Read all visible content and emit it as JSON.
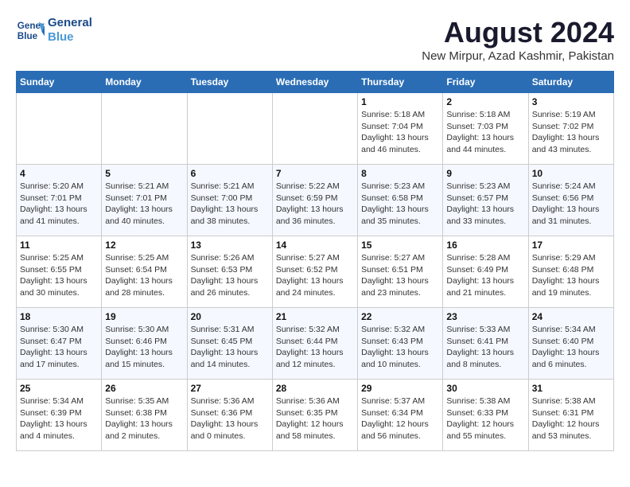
{
  "logo": {
    "line1": "General",
    "line2": "Blue"
  },
  "title": "August 2024",
  "location": "New Mirpur, Azad Kashmir, Pakistan",
  "days_of_week": [
    "Sunday",
    "Monday",
    "Tuesday",
    "Wednesday",
    "Thursday",
    "Friday",
    "Saturday"
  ],
  "weeks": [
    [
      {
        "day": "",
        "detail": ""
      },
      {
        "day": "",
        "detail": ""
      },
      {
        "day": "",
        "detail": ""
      },
      {
        "day": "",
        "detail": ""
      },
      {
        "day": "1",
        "detail": "Sunrise: 5:18 AM\nSunset: 7:04 PM\nDaylight: 13 hours\nand 46 minutes."
      },
      {
        "day": "2",
        "detail": "Sunrise: 5:18 AM\nSunset: 7:03 PM\nDaylight: 13 hours\nand 44 minutes."
      },
      {
        "day": "3",
        "detail": "Sunrise: 5:19 AM\nSunset: 7:02 PM\nDaylight: 13 hours\nand 43 minutes."
      }
    ],
    [
      {
        "day": "4",
        "detail": "Sunrise: 5:20 AM\nSunset: 7:01 PM\nDaylight: 13 hours\nand 41 minutes."
      },
      {
        "day": "5",
        "detail": "Sunrise: 5:21 AM\nSunset: 7:01 PM\nDaylight: 13 hours\nand 40 minutes."
      },
      {
        "day": "6",
        "detail": "Sunrise: 5:21 AM\nSunset: 7:00 PM\nDaylight: 13 hours\nand 38 minutes."
      },
      {
        "day": "7",
        "detail": "Sunrise: 5:22 AM\nSunset: 6:59 PM\nDaylight: 13 hours\nand 36 minutes."
      },
      {
        "day": "8",
        "detail": "Sunrise: 5:23 AM\nSunset: 6:58 PM\nDaylight: 13 hours\nand 35 minutes."
      },
      {
        "day": "9",
        "detail": "Sunrise: 5:23 AM\nSunset: 6:57 PM\nDaylight: 13 hours\nand 33 minutes."
      },
      {
        "day": "10",
        "detail": "Sunrise: 5:24 AM\nSunset: 6:56 PM\nDaylight: 13 hours\nand 31 minutes."
      }
    ],
    [
      {
        "day": "11",
        "detail": "Sunrise: 5:25 AM\nSunset: 6:55 PM\nDaylight: 13 hours\nand 30 minutes."
      },
      {
        "day": "12",
        "detail": "Sunrise: 5:25 AM\nSunset: 6:54 PM\nDaylight: 13 hours\nand 28 minutes."
      },
      {
        "day": "13",
        "detail": "Sunrise: 5:26 AM\nSunset: 6:53 PM\nDaylight: 13 hours\nand 26 minutes."
      },
      {
        "day": "14",
        "detail": "Sunrise: 5:27 AM\nSunset: 6:52 PM\nDaylight: 13 hours\nand 24 minutes."
      },
      {
        "day": "15",
        "detail": "Sunrise: 5:27 AM\nSunset: 6:51 PM\nDaylight: 13 hours\nand 23 minutes."
      },
      {
        "day": "16",
        "detail": "Sunrise: 5:28 AM\nSunset: 6:49 PM\nDaylight: 13 hours\nand 21 minutes."
      },
      {
        "day": "17",
        "detail": "Sunrise: 5:29 AM\nSunset: 6:48 PM\nDaylight: 13 hours\nand 19 minutes."
      }
    ],
    [
      {
        "day": "18",
        "detail": "Sunrise: 5:30 AM\nSunset: 6:47 PM\nDaylight: 13 hours\nand 17 minutes."
      },
      {
        "day": "19",
        "detail": "Sunrise: 5:30 AM\nSunset: 6:46 PM\nDaylight: 13 hours\nand 15 minutes."
      },
      {
        "day": "20",
        "detail": "Sunrise: 5:31 AM\nSunset: 6:45 PM\nDaylight: 13 hours\nand 14 minutes."
      },
      {
        "day": "21",
        "detail": "Sunrise: 5:32 AM\nSunset: 6:44 PM\nDaylight: 13 hours\nand 12 minutes."
      },
      {
        "day": "22",
        "detail": "Sunrise: 5:32 AM\nSunset: 6:43 PM\nDaylight: 13 hours\nand 10 minutes."
      },
      {
        "day": "23",
        "detail": "Sunrise: 5:33 AM\nSunset: 6:41 PM\nDaylight: 13 hours\nand 8 minutes."
      },
      {
        "day": "24",
        "detail": "Sunrise: 5:34 AM\nSunset: 6:40 PM\nDaylight: 13 hours\nand 6 minutes."
      }
    ],
    [
      {
        "day": "25",
        "detail": "Sunrise: 5:34 AM\nSunset: 6:39 PM\nDaylight: 13 hours\nand 4 minutes."
      },
      {
        "day": "26",
        "detail": "Sunrise: 5:35 AM\nSunset: 6:38 PM\nDaylight: 13 hours\nand 2 minutes."
      },
      {
        "day": "27",
        "detail": "Sunrise: 5:36 AM\nSunset: 6:36 PM\nDaylight: 13 hours\nand 0 minutes."
      },
      {
        "day": "28",
        "detail": "Sunrise: 5:36 AM\nSunset: 6:35 PM\nDaylight: 12 hours\nand 58 minutes."
      },
      {
        "day": "29",
        "detail": "Sunrise: 5:37 AM\nSunset: 6:34 PM\nDaylight: 12 hours\nand 56 minutes."
      },
      {
        "day": "30",
        "detail": "Sunrise: 5:38 AM\nSunset: 6:33 PM\nDaylight: 12 hours\nand 55 minutes."
      },
      {
        "day": "31",
        "detail": "Sunrise: 5:38 AM\nSunset: 6:31 PM\nDaylight: 12 hours\nand 53 minutes."
      }
    ]
  ]
}
